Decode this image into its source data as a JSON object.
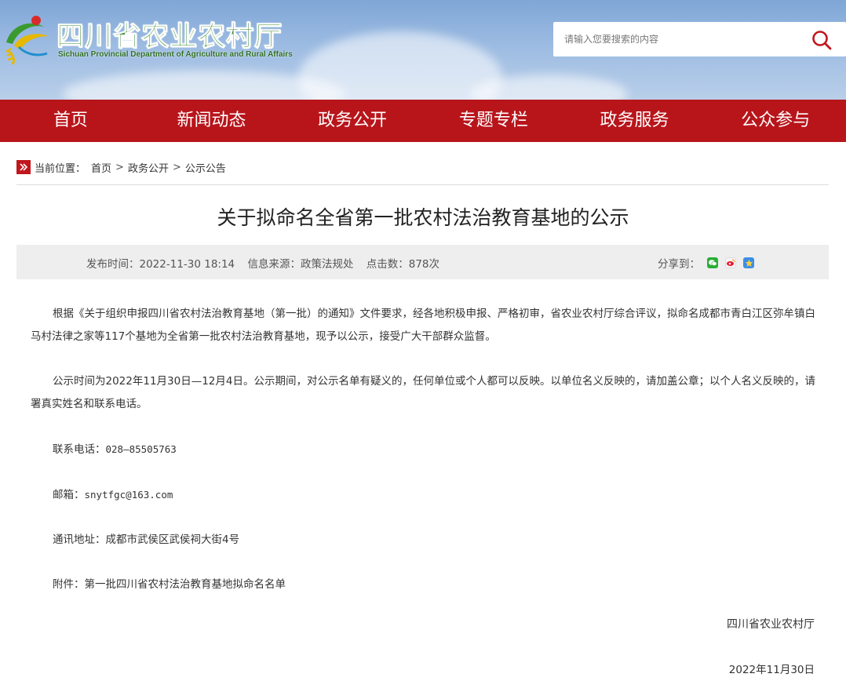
{
  "header": {
    "title": "四川省农业农村厅",
    "subtitle": "Sichuan Provincial Department of Agriculture and Rural Affairs",
    "logo_icon": "sichuan-agri-logo-icon"
  },
  "search": {
    "placeholder": "请输入您要搜索的内容",
    "icon": "search-icon",
    "accent": "#c0171d"
  },
  "nav": {
    "color": "#b8151b",
    "items": [
      "首页",
      "新闻动态",
      "政务公开",
      "专题专栏",
      "政务服务",
      "公众参与"
    ]
  },
  "breadcrumb": {
    "prefix": "当前位置：",
    "items": [
      "首页",
      "政务公开",
      "公示公告"
    ],
    "separator": ">"
  },
  "article": {
    "title": "关于拟命名全省第一批农村法治教育基地的公示",
    "meta": {
      "publish_time": "发布时间：2022-11-30 18:14",
      "source": "信息来源：政策法规处",
      "clicks": "点击数：878次"
    },
    "share_label": "分享到：",
    "share_icons": [
      "wechat-icon",
      "weibo-icon",
      "qzone-icon"
    ],
    "paragraphs": [
      "根据《关于组织申报四川省农村法治教育基地（第一批）的通知》文件要求，经各地积极申报、严格初审，省农业农村厅综合评议，拟命名成都市青白江区弥牟镇白马村法律之家等117个基地为全省第一批农村法治教育基地，现予以公示，接受广大干部群众监督。",
      "公示时间为2022年11月30日—12月4日。公示期间，对公示名单有疑义的，任何单位或个人都可以反映。以单位名义反映的，请加盖公章；以个人名义反映的，请署真实姓名和联系电话。"
    ],
    "phone_label": "联系电话：",
    "phone": "028—85505763",
    "email_label": "邮箱：",
    "email": "snytfgc@163.com",
    "address": "通讯地址：成都市武侯区武侯祠大街4号",
    "attachment_label": "附件：",
    "attachment": "第一批四川省农村法治教育基地拟命名名单",
    "signature": "四川省农业农村厅",
    "date": "2022年11月30日"
  }
}
